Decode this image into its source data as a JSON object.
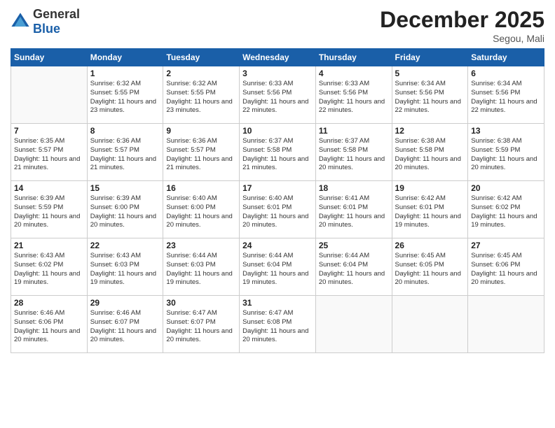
{
  "logo": {
    "general": "General",
    "blue": "Blue"
  },
  "title": "December 2025",
  "location": "Segou, Mali",
  "days_of_week": [
    "Sunday",
    "Monday",
    "Tuesday",
    "Wednesday",
    "Thursday",
    "Friday",
    "Saturday"
  ],
  "weeks": [
    [
      {
        "day": "",
        "info": ""
      },
      {
        "day": "1",
        "info": "Sunrise: 6:32 AM\nSunset: 5:55 PM\nDaylight: 11 hours and 23 minutes."
      },
      {
        "day": "2",
        "info": "Sunrise: 6:32 AM\nSunset: 5:55 PM\nDaylight: 11 hours and 23 minutes."
      },
      {
        "day": "3",
        "info": "Sunrise: 6:33 AM\nSunset: 5:56 PM\nDaylight: 11 hours and 22 minutes."
      },
      {
        "day": "4",
        "info": "Sunrise: 6:33 AM\nSunset: 5:56 PM\nDaylight: 11 hours and 22 minutes."
      },
      {
        "day": "5",
        "info": "Sunrise: 6:34 AM\nSunset: 5:56 PM\nDaylight: 11 hours and 22 minutes."
      },
      {
        "day": "6",
        "info": "Sunrise: 6:34 AM\nSunset: 5:56 PM\nDaylight: 11 hours and 22 minutes."
      }
    ],
    [
      {
        "day": "7",
        "info": "Sunrise: 6:35 AM\nSunset: 5:57 PM\nDaylight: 11 hours and 21 minutes."
      },
      {
        "day": "8",
        "info": "Sunrise: 6:36 AM\nSunset: 5:57 PM\nDaylight: 11 hours and 21 minutes."
      },
      {
        "day": "9",
        "info": "Sunrise: 6:36 AM\nSunset: 5:57 PM\nDaylight: 11 hours and 21 minutes."
      },
      {
        "day": "10",
        "info": "Sunrise: 6:37 AM\nSunset: 5:58 PM\nDaylight: 11 hours and 21 minutes."
      },
      {
        "day": "11",
        "info": "Sunrise: 6:37 AM\nSunset: 5:58 PM\nDaylight: 11 hours and 20 minutes."
      },
      {
        "day": "12",
        "info": "Sunrise: 6:38 AM\nSunset: 5:58 PM\nDaylight: 11 hours and 20 minutes."
      },
      {
        "day": "13",
        "info": "Sunrise: 6:38 AM\nSunset: 5:59 PM\nDaylight: 11 hours and 20 minutes."
      }
    ],
    [
      {
        "day": "14",
        "info": "Sunrise: 6:39 AM\nSunset: 5:59 PM\nDaylight: 11 hours and 20 minutes."
      },
      {
        "day": "15",
        "info": "Sunrise: 6:39 AM\nSunset: 6:00 PM\nDaylight: 11 hours and 20 minutes."
      },
      {
        "day": "16",
        "info": "Sunrise: 6:40 AM\nSunset: 6:00 PM\nDaylight: 11 hours and 20 minutes."
      },
      {
        "day": "17",
        "info": "Sunrise: 6:40 AM\nSunset: 6:01 PM\nDaylight: 11 hours and 20 minutes."
      },
      {
        "day": "18",
        "info": "Sunrise: 6:41 AM\nSunset: 6:01 PM\nDaylight: 11 hours and 20 minutes."
      },
      {
        "day": "19",
        "info": "Sunrise: 6:42 AM\nSunset: 6:01 PM\nDaylight: 11 hours and 19 minutes."
      },
      {
        "day": "20",
        "info": "Sunrise: 6:42 AM\nSunset: 6:02 PM\nDaylight: 11 hours and 19 minutes."
      }
    ],
    [
      {
        "day": "21",
        "info": "Sunrise: 6:43 AM\nSunset: 6:02 PM\nDaylight: 11 hours and 19 minutes."
      },
      {
        "day": "22",
        "info": "Sunrise: 6:43 AM\nSunset: 6:03 PM\nDaylight: 11 hours and 19 minutes."
      },
      {
        "day": "23",
        "info": "Sunrise: 6:44 AM\nSunset: 6:03 PM\nDaylight: 11 hours and 19 minutes."
      },
      {
        "day": "24",
        "info": "Sunrise: 6:44 AM\nSunset: 6:04 PM\nDaylight: 11 hours and 19 minutes."
      },
      {
        "day": "25",
        "info": "Sunrise: 6:44 AM\nSunset: 6:04 PM\nDaylight: 11 hours and 20 minutes."
      },
      {
        "day": "26",
        "info": "Sunrise: 6:45 AM\nSunset: 6:05 PM\nDaylight: 11 hours and 20 minutes."
      },
      {
        "day": "27",
        "info": "Sunrise: 6:45 AM\nSunset: 6:06 PM\nDaylight: 11 hours and 20 minutes."
      }
    ],
    [
      {
        "day": "28",
        "info": "Sunrise: 6:46 AM\nSunset: 6:06 PM\nDaylight: 11 hours and 20 minutes."
      },
      {
        "day": "29",
        "info": "Sunrise: 6:46 AM\nSunset: 6:07 PM\nDaylight: 11 hours and 20 minutes."
      },
      {
        "day": "30",
        "info": "Sunrise: 6:47 AM\nSunset: 6:07 PM\nDaylight: 11 hours and 20 minutes."
      },
      {
        "day": "31",
        "info": "Sunrise: 6:47 AM\nSunset: 6:08 PM\nDaylight: 11 hours and 20 minutes."
      },
      {
        "day": "",
        "info": ""
      },
      {
        "day": "",
        "info": ""
      },
      {
        "day": "",
        "info": ""
      }
    ]
  ]
}
